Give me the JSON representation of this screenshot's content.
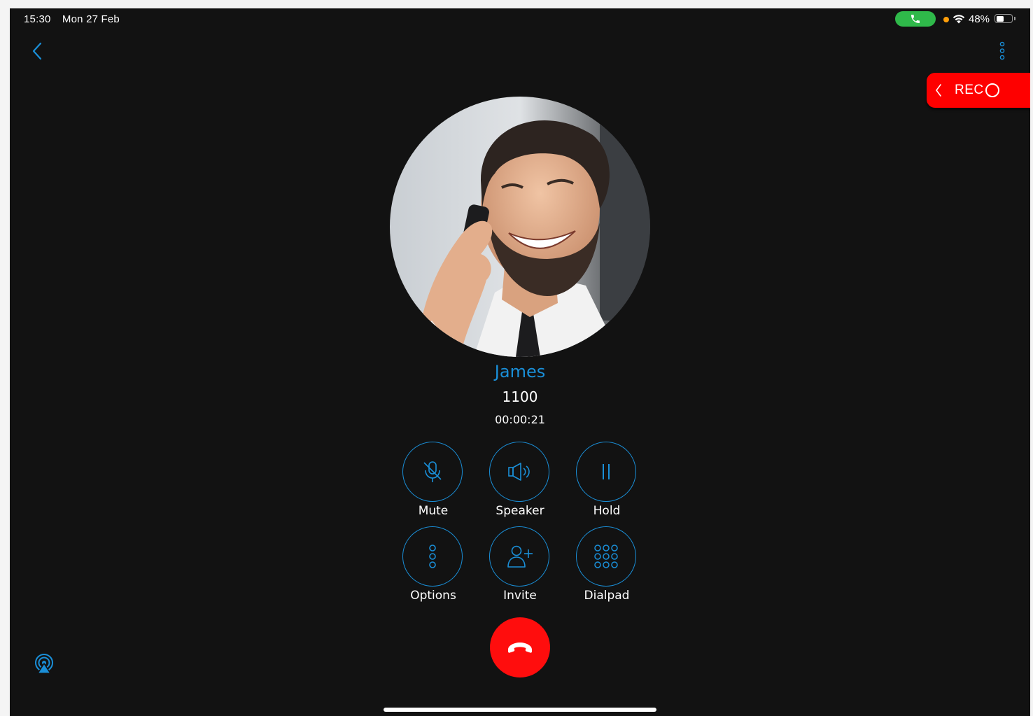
{
  "status_bar": {
    "time": "15:30",
    "date": "Mon 27 Feb",
    "battery_percent": "48%",
    "battery_level": 0.48
  },
  "recording": {
    "label": "REC"
  },
  "caller": {
    "name": "James",
    "number": "1100",
    "duration": "00:00:21"
  },
  "controls": {
    "mute": "Mute",
    "speaker": "Speaker",
    "hold": "Hold",
    "options": "Options",
    "invite": "Invite",
    "dialpad": "Dialpad"
  },
  "colors": {
    "accent": "#1a8fd8",
    "background": "#121212",
    "hangup": "#ff0d0d",
    "rec_tab": "#fe0000",
    "call_pill": "#2fb94a"
  },
  "icons": {
    "back": "chevron-left-icon",
    "more": "vertical-dots-icon",
    "mute": "microphone-off-icon",
    "speaker": "speaker-icon",
    "hold": "pause-icon",
    "options": "vertical-dots-icon",
    "invite": "add-user-icon",
    "dialpad": "dialpad-icon",
    "hangup": "phone-hangup-icon",
    "airplay": "airplay-icon"
  }
}
